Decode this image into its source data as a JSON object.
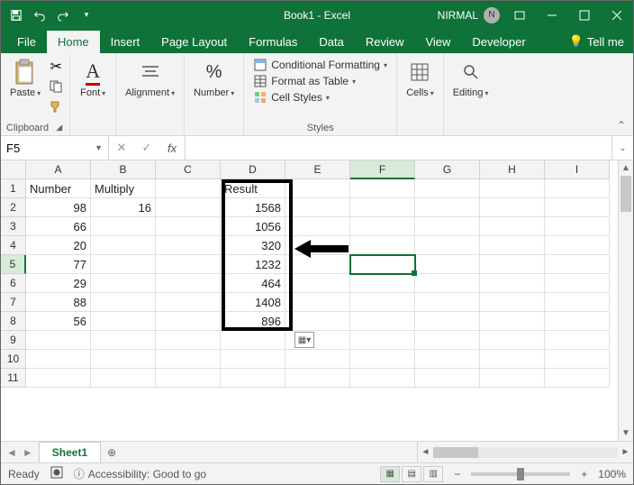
{
  "titlebar": {
    "doc": "Book1 - Excel",
    "user": "NIRMAL",
    "initial": "N"
  },
  "tabs": {
    "file": "File",
    "home": "Home",
    "insert": "Insert",
    "pagelayout": "Page Layout",
    "formulas": "Formulas",
    "data": "Data",
    "review": "Review",
    "view": "View",
    "developer": "Developer",
    "tellme": "Tell me"
  },
  "ribbon": {
    "paste": "Paste",
    "clipboard": "Clipboard",
    "font": "Font",
    "alignment": "Alignment",
    "number": "Number",
    "cond_fmt": "Conditional Formatting",
    "fmt_table": "Format as Table",
    "cell_styles": "Cell Styles",
    "styles": "Styles",
    "cells": "Cells",
    "editing": "Editing"
  },
  "formula": {
    "namebox": "F5",
    "fx": "fx",
    "value": ""
  },
  "columns": [
    "A",
    "B",
    "C",
    "D",
    "E",
    "F",
    "G",
    "H",
    "I"
  ],
  "data_headers": {
    "a": "Number",
    "b": "Multiply",
    "d": "Result"
  },
  "data_rows": [
    {
      "a": "98",
      "b": "16",
      "d": "1568"
    },
    {
      "a": "66",
      "b": "",
      "d": "1056"
    },
    {
      "a": "20",
      "b": "",
      "d": "320"
    },
    {
      "a": "77",
      "b": "",
      "d": "1232"
    },
    {
      "a": "29",
      "b": "",
      "d": "464"
    },
    {
      "a": "88",
      "b": "",
      "d": "1408"
    },
    {
      "a": "56",
      "b": "",
      "d": "896"
    }
  ],
  "sheet": {
    "name": "Sheet1"
  },
  "status": {
    "ready": "Ready",
    "accessibility": "Accessibility: Good to go",
    "zoom": "100%"
  }
}
